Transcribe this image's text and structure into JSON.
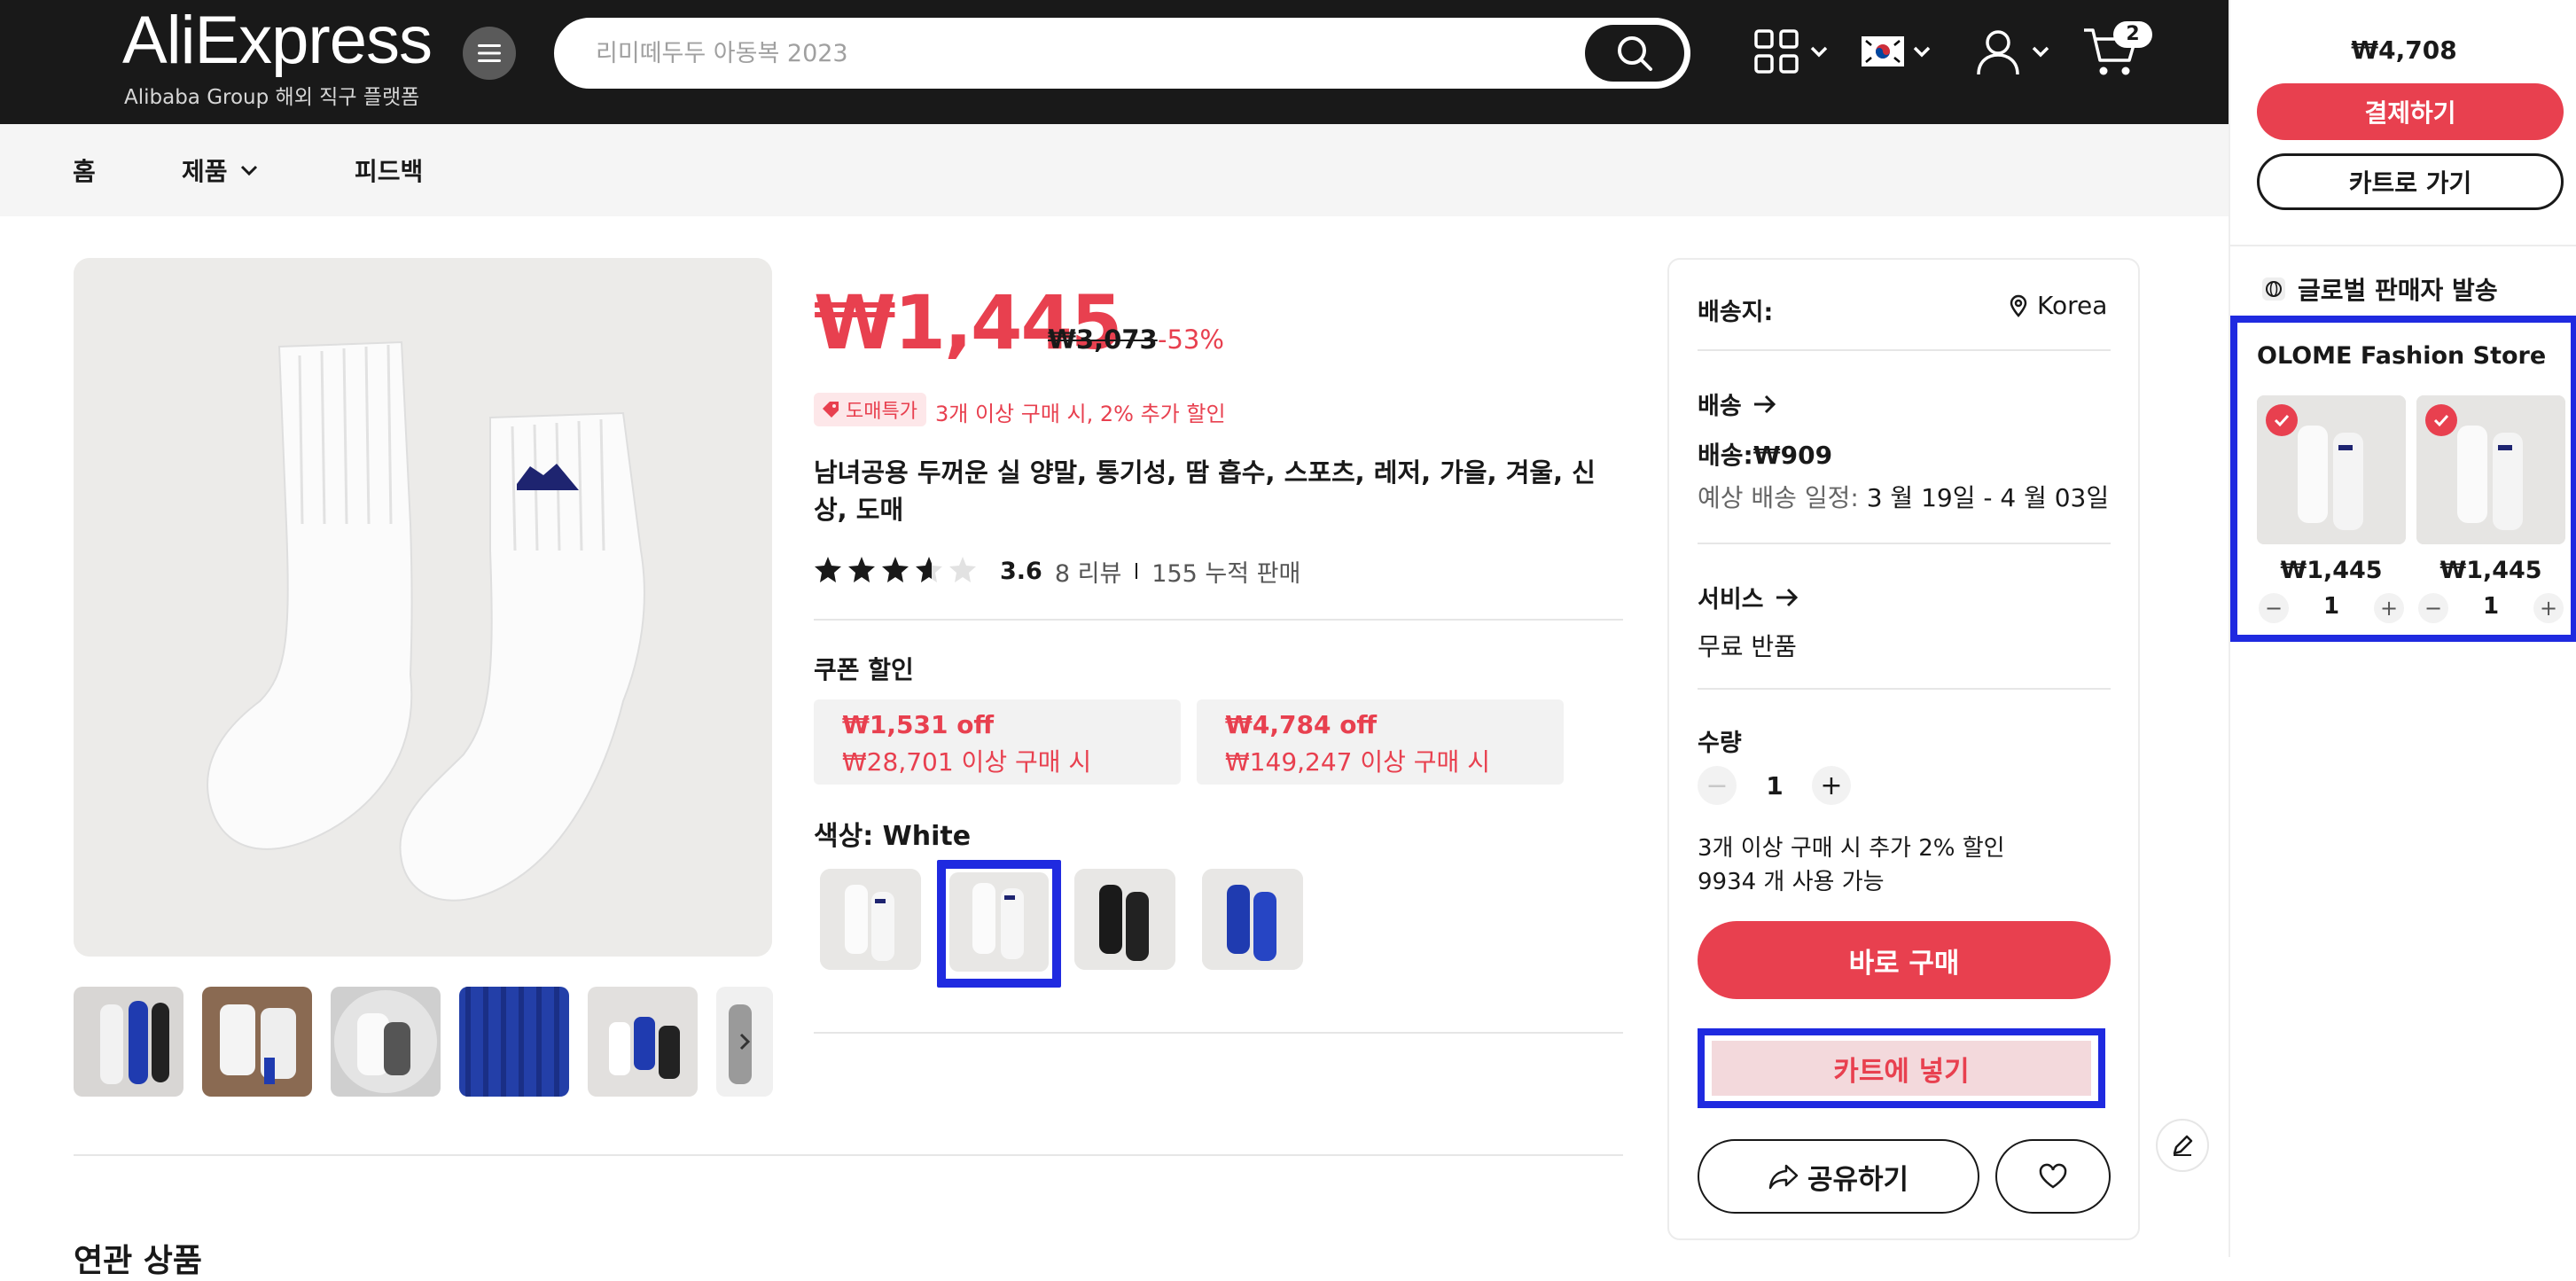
{
  "header": {
    "logo": "AliExpress",
    "logo_sub": "Alibaba Group 해외 직구 플랫폼",
    "search_placeholder": "리미떼두두 아동복 2023",
    "cart_count": "2"
  },
  "nav": {
    "home": "홈",
    "products": "제품",
    "feedback": "피드백"
  },
  "product": {
    "price": "₩1,445",
    "original_price": "₩3,073",
    "discount": "-53%",
    "deal_badge": "도매특가",
    "deal_text": "3개 이상 구매 시, 2% 추가 할인",
    "title": "남녀공용 두꺼운 실 양말, 통기성, 땀 흡수, 스포츠, 레저, 가을, 겨울, 신상, 도매",
    "rating": "3.6",
    "rating_value": 3.6,
    "reviews": "8 리뷰",
    "sold": "155 누적 판매",
    "coupon_label": "쿠폰 할인",
    "coupons": [
      {
        "off": "₩1,531 off",
        "cond": "₩28,701 이상 구매 시"
      },
      {
        "off": "₩4,784 off",
        "cond": "₩149,247 이상 구매 시"
      }
    ],
    "color_label": "색상: White",
    "colors": [
      "white-embroidered",
      "white",
      "black",
      "blue"
    ],
    "selected_color_index": 1
  },
  "buy": {
    "ship_to_label": "배송지:",
    "ship_to_value": "Korea",
    "shipping_label": "배송",
    "shipping_fee": "배송:₩909",
    "eta_label": "예상 배송 일정:",
    "eta_value": "3 월 19일 - 4 월 03일",
    "service_label": "서비스",
    "service_value": "무료 반품",
    "qty_label": "수량",
    "qty_value": "1",
    "qty_note": "3개 이상 구매 시 추가 2% 할인",
    "stock": "9934 개 사용 가능",
    "buy_now": "바로 구매",
    "add_to_cart": "카트에 넣기",
    "share": "공유하기"
  },
  "related_title": "연관 상품",
  "mini_cart": {
    "total": "₩4,708",
    "checkout": "결제하기",
    "go_cart": "카트로 가기",
    "seller_type": "글로벌 판매자 발송",
    "store": "OLOME Fashion Store",
    "items": [
      {
        "price": "₩1,445",
        "qty": "1"
      },
      {
        "price": "₩1,445",
        "qty": "1"
      }
    ]
  },
  "colors": {
    "accent": "#e8404f",
    "header_bg": "#191919",
    "highlight": "#1f2ae0"
  }
}
